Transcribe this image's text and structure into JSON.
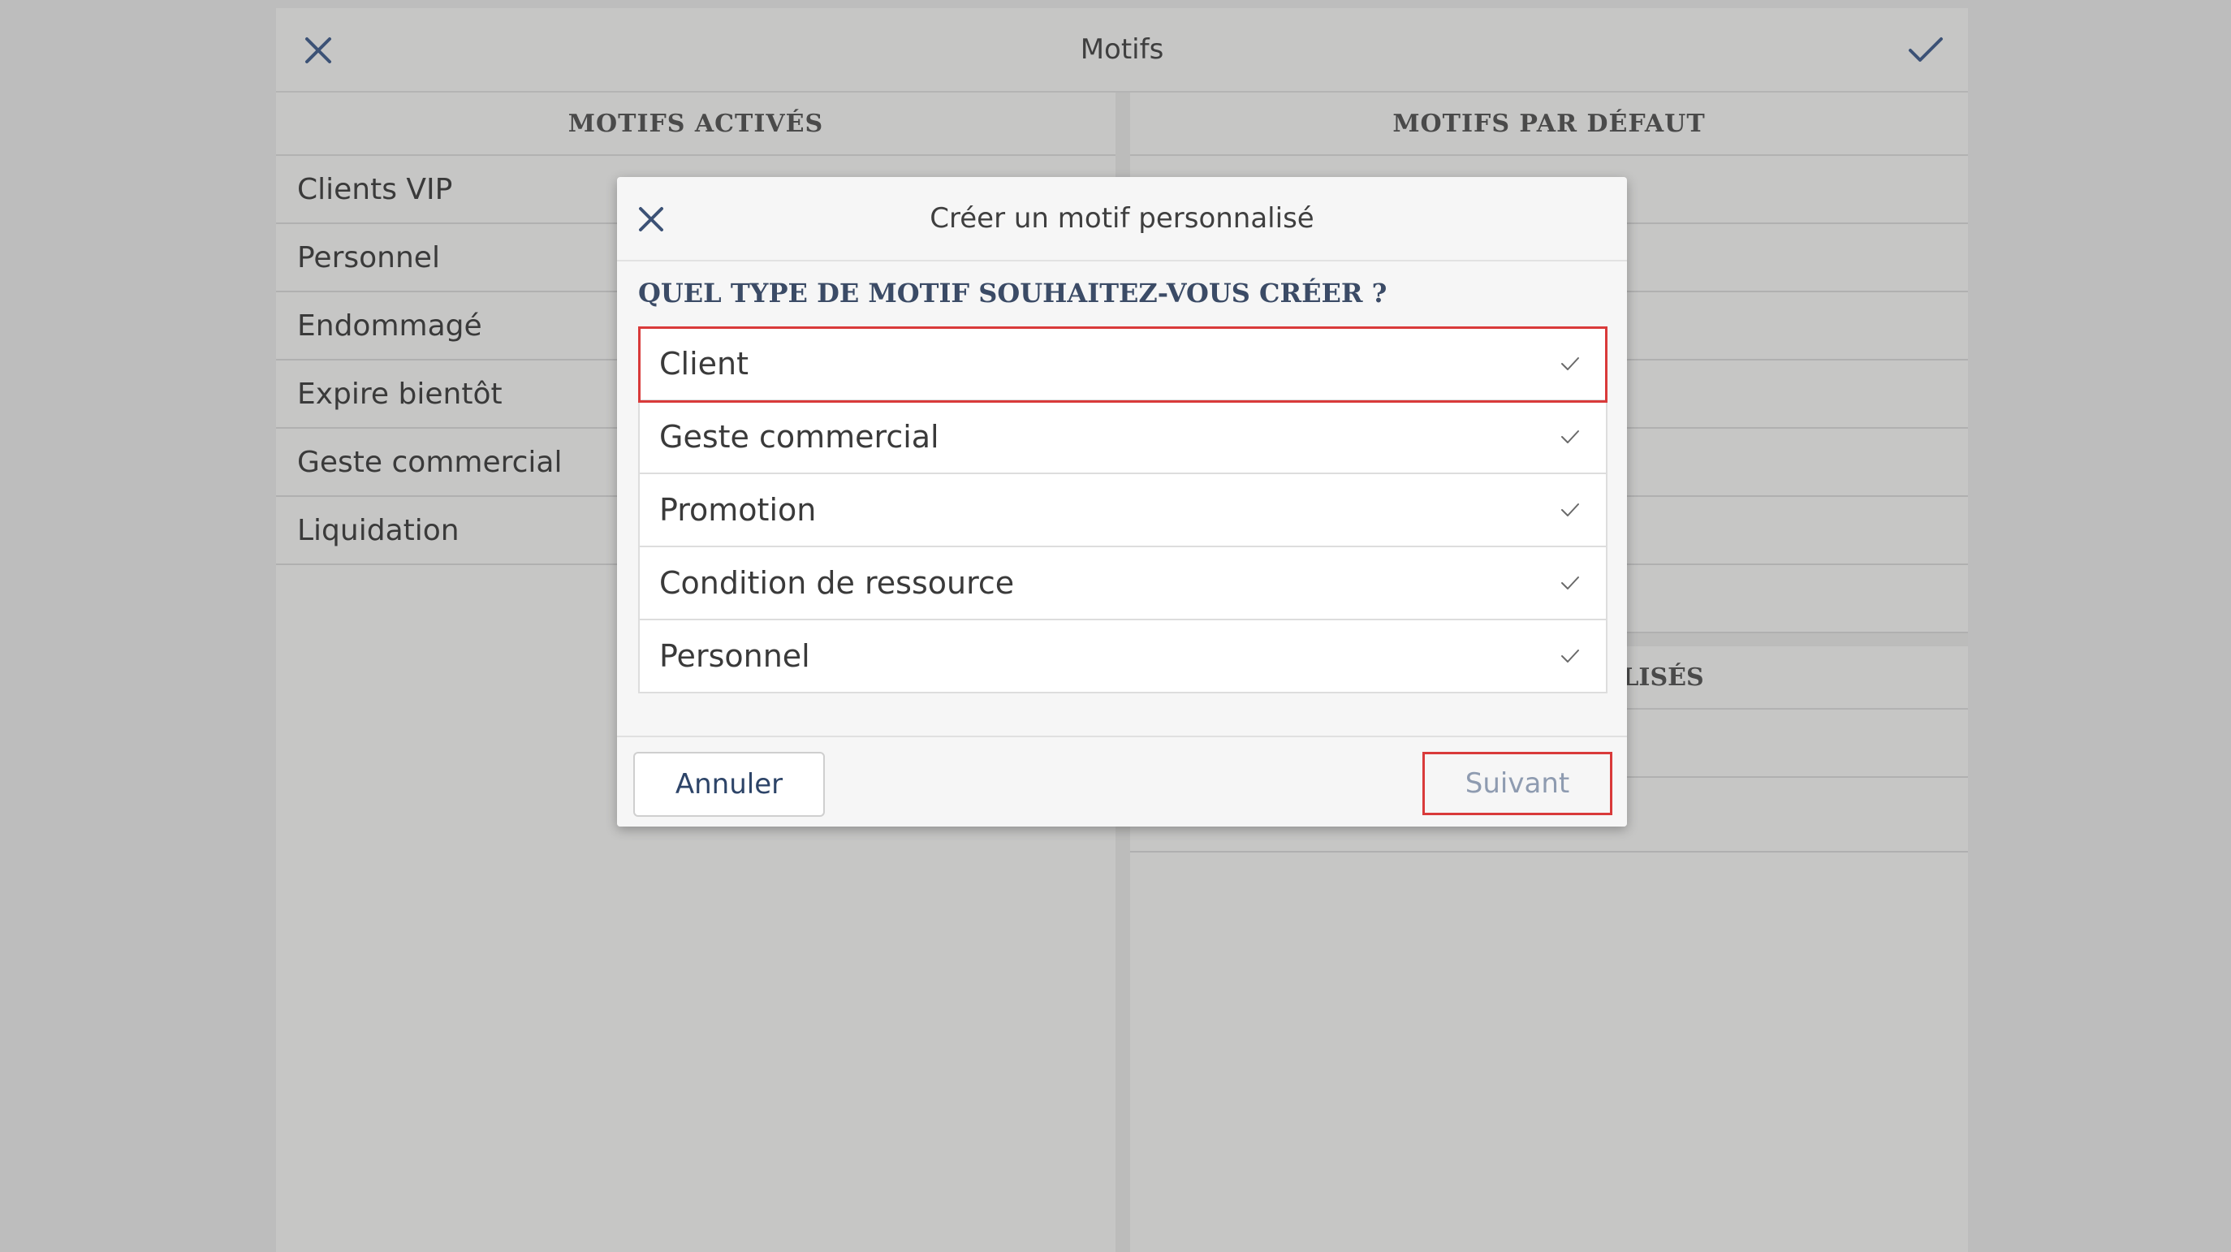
{
  "header": {
    "title": "Motifs"
  },
  "left_column": {
    "heading": "MOTIFS ACTIVÉS",
    "items": [
      "Clients VIP",
      "Personnel",
      "Endommagé",
      "Expire bientôt",
      "Geste commercial",
      "Liquidation"
    ]
  },
  "right_column": {
    "heading": "MOTIFS PAR DÉFAUT",
    "custom_heading_partial": "LISÉS"
  },
  "dialog": {
    "title": "Créer un motif personnalisé",
    "question": "QUEL TYPE DE MOTIF SOUHAITEZ-VOUS CRÉER ?",
    "options": [
      {
        "label": "Client",
        "selected": true
      },
      {
        "label": "Geste commercial",
        "selected": false
      },
      {
        "label": "Promotion",
        "selected": false
      },
      {
        "label": "Condition de ressource",
        "selected": false
      },
      {
        "label": "Personnel",
        "selected": false
      }
    ],
    "cancel_label": "Annuler",
    "next_label": "Suivant"
  },
  "colors": {
    "accent": "#3c5276",
    "highlight": "#d93a3a"
  },
  "icons": {
    "close": "close-icon",
    "confirm": "checkmark-icon",
    "option_check": "checkmark-icon"
  }
}
